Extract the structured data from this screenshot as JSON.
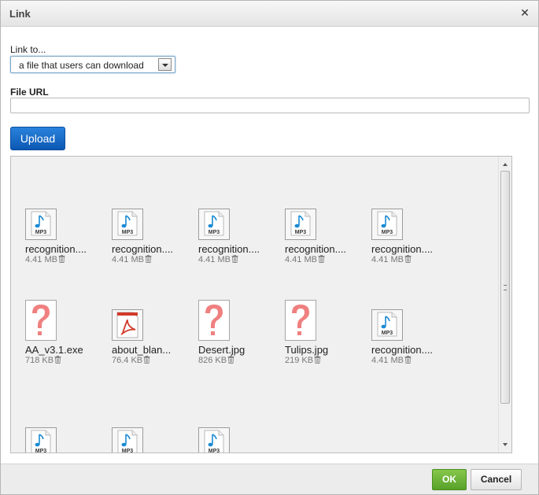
{
  "dialog": {
    "title": "Link"
  },
  "link_to": {
    "label": "Link to...",
    "selected": "a file that users can download"
  },
  "file_url": {
    "label": "File URL",
    "value": "",
    "placeholder": ""
  },
  "upload": {
    "label": "Upload"
  },
  "files": [
    {
      "name": "recognition....",
      "size": "4.41 MB",
      "type": "mp3"
    },
    {
      "name": "recognition....",
      "size": "4.41 MB",
      "type": "mp3"
    },
    {
      "name": "recognition....",
      "size": "4.41 MB",
      "type": "mp3"
    },
    {
      "name": "recognition....",
      "size": "4.41 MB",
      "type": "mp3"
    },
    {
      "name": "recognition....",
      "size": "4.41 MB",
      "type": "mp3"
    },
    {
      "name": "AA_v3.1.exe",
      "size": "718 KB",
      "type": "unknown"
    },
    {
      "name": "about_blan...",
      "size": "76.4 KB",
      "type": "pdf"
    },
    {
      "name": "Desert.jpg",
      "size": "826 KB",
      "type": "unknown"
    },
    {
      "name": "Tulips.jpg",
      "size": "219 KB",
      "type": "unknown"
    },
    {
      "name": "recognition....",
      "size": "4.41 MB",
      "type": "mp3"
    },
    {
      "name": "",
      "size": "",
      "type": "mp3"
    },
    {
      "name": "",
      "size": "",
      "type": "mp3"
    },
    {
      "name": "",
      "size": "",
      "type": "mp3"
    }
  ],
  "icons": {
    "mp3_badge": "MP3",
    "note_color": "#1a8ad4",
    "unknown_color": "#f08080",
    "pdf_color": "#d23a2a"
  },
  "footer": {
    "ok_label": "OK",
    "cancel_label": "Cancel"
  }
}
